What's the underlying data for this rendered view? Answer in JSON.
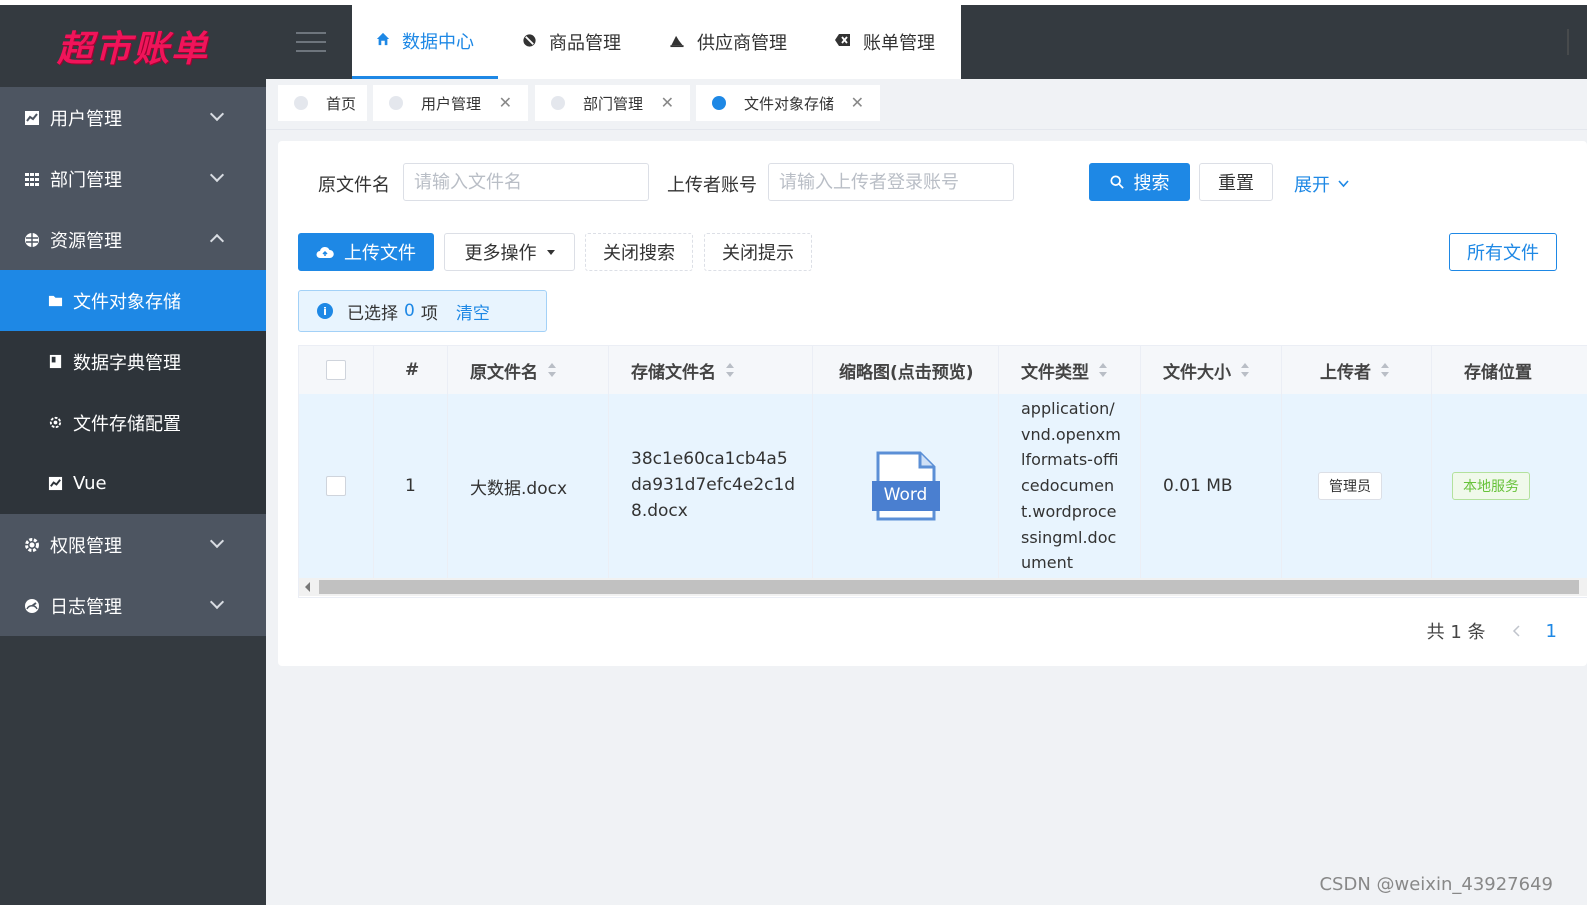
{
  "app": {
    "logo_text": "超市账单"
  },
  "sidebar": {
    "menus": [
      {
        "label": "用户管理",
        "icon": "chart-icon"
      },
      {
        "label": "部门管理",
        "icon": "grid-icon"
      },
      {
        "label": "资源管理",
        "icon": "globe-icon"
      }
    ],
    "submenu": [
      {
        "label": "文件对象存储",
        "icon": "folder-icon"
      },
      {
        "label": "数据字典管理",
        "icon": "book-icon"
      },
      {
        "label": "文件存储配置",
        "icon": "gear-icon"
      },
      {
        "label": "Vue",
        "icon": "chart-icon"
      }
    ],
    "menus_after": [
      {
        "label": "权限管理",
        "icon": "gear-icon"
      },
      {
        "label": "日志管理",
        "icon": "dashboard-icon"
      }
    ]
  },
  "topnav": [
    {
      "label": "数据中心",
      "icon": "home-icon"
    },
    {
      "label": "商品管理",
      "icon": "tag-icon"
    },
    {
      "label": "供应商管理",
      "icon": "truck-icon"
    },
    {
      "label": "账单管理",
      "icon": "bill-icon"
    }
  ],
  "tags": [
    {
      "label": "首页"
    },
    {
      "label": "用户管理"
    },
    {
      "label": "部门管理"
    },
    {
      "label": "文件对象存储"
    }
  ],
  "search": {
    "filename_label": "原文件名",
    "filename_placeholder": "请输入文件名",
    "uploader_label": "上传者账号",
    "uploader_placeholder": "请输入上传者登录账号",
    "search_btn": "搜索",
    "reset_btn": "重置",
    "expand_btn": "展开"
  },
  "toolbar": {
    "upload_btn": "上传文件",
    "more_btn": "更多操作",
    "close_search_btn": "关闭搜索",
    "close_tip_btn": "关闭提示",
    "all_files_btn": "所有文件"
  },
  "alert": {
    "prefix": "已选择",
    "count": "0",
    "suffix": "项",
    "clear": "清空"
  },
  "table": {
    "columns": [
      "#",
      "原文件名",
      "存储文件名",
      "缩略图(点击预览)",
      "文件类型",
      "文件大小",
      "上传者",
      "存储位置"
    ],
    "rows": [
      {
        "index": "1",
        "original_name": "大数据.docx",
        "stored_name": "38c1e60ca1cb4a5da931d7efc4e2c1d8.docx",
        "thumb_label": "Word",
        "file_type": "application/vnd.openxmlformats-officedocument.wordprocessingml.document",
        "file_size": "0.01 MB",
        "uploader": "管理员",
        "location": "本地服务"
      }
    ]
  },
  "pagination": {
    "total": "共 1 条",
    "current": "1"
  },
  "watermark": "CSDN @weixin_43927649",
  "colors": {
    "primary": "#1e88e5",
    "sidebar": "#343a40",
    "logo": "#f0145a",
    "success": "#67c23a"
  }
}
